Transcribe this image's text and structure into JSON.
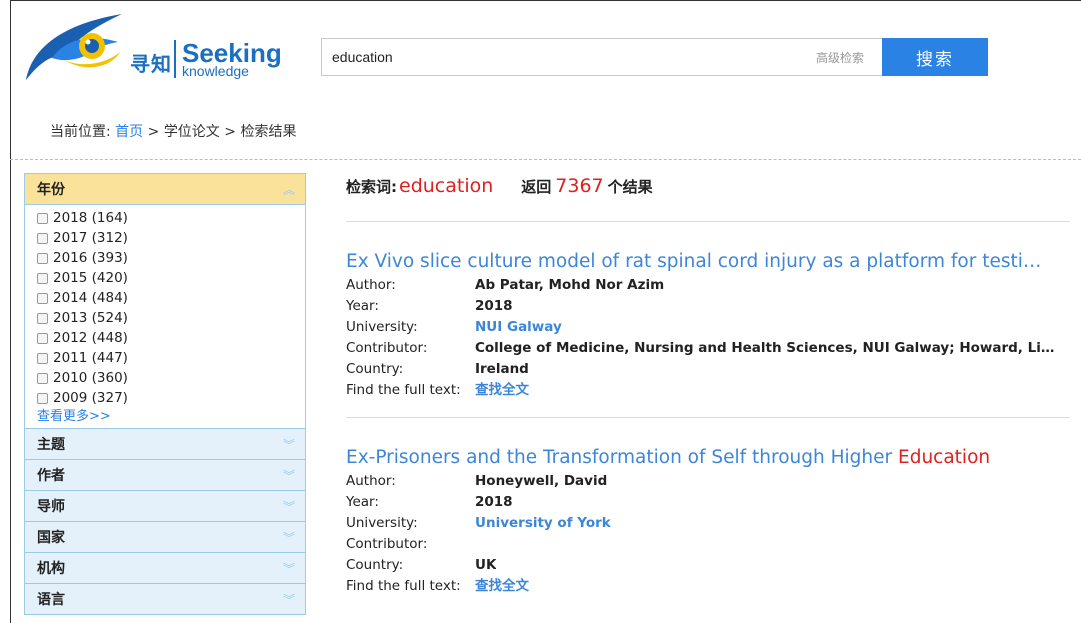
{
  "logo": {
    "cn": "寻知",
    "en_big": "Seeking",
    "en_small": "knowledge"
  },
  "search": {
    "value": "education",
    "advanced_label": "高级检索",
    "button_label": "搜索"
  },
  "breadcrumb": {
    "prefix": "当前位置:",
    "home": "首页",
    "sep1": ">",
    "section": "学位论文",
    "sep2": ">",
    "current": "检索结果"
  },
  "sidebar": {
    "year_title": "年份",
    "years": [
      {
        "label": "2018 (164)"
      },
      {
        "label": "2017 (312)"
      },
      {
        "label": "2016 (393)"
      },
      {
        "label": "2015 (420)"
      },
      {
        "label": "2014 (484)"
      },
      {
        "label": "2013 (524)"
      },
      {
        "label": "2012 (448)"
      },
      {
        "label": "2011 (447)"
      },
      {
        "label": "2010 (360)"
      },
      {
        "label": "2009 (327)"
      }
    ],
    "more": "查看更多>>",
    "facets": [
      "主题",
      "作者",
      "导师",
      "国家",
      "机构",
      "语言"
    ]
  },
  "summary": {
    "kw_label": "检索词:",
    "keyword": "education",
    "ret_label": "返回",
    "count": "7367",
    "count_suffix": "个结果"
  },
  "field_labels": {
    "author": "Author:",
    "year": "Year:",
    "university": "University:",
    "contributor": "Contributor:",
    "country": "Country:",
    "fulltext": "Find the full text:"
  },
  "results": [
    {
      "title": "Ex Vivo slice culture model of rat spinal cord injury as a platform for testi…",
      "title_highlight": "",
      "author": "Ab Patar, Mohd Nor Azim",
      "year": "2018",
      "university": "NUI Galway",
      "contributor": "College of Medicine, Nursing and Health Sciences, NUI Galway; Howard, Linda…",
      "country": "Ireland",
      "fulltext": "查找全文"
    },
    {
      "title": "Ex-Prisoners and the Transformation of Self through Higher ",
      "title_highlight": "Education",
      "author": "Honeywell, David",
      "year": "2018",
      "university": "University of York",
      "contributor": "",
      "country": "UK",
      "fulltext": "查找全文"
    }
  ]
}
